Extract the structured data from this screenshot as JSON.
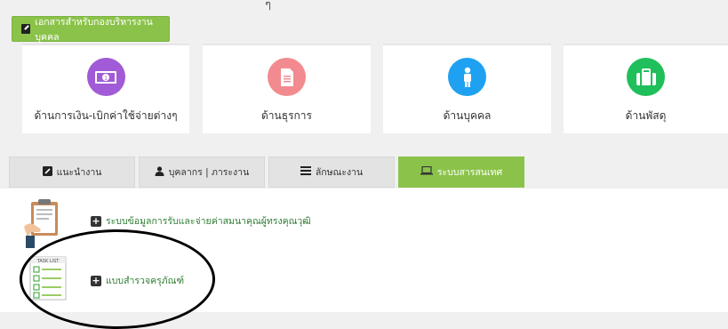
{
  "top": {
    "glyph": "ๆ"
  },
  "docs_button": {
    "label": "เอกสารสำหรับกองบริหารงานบุคคล"
  },
  "cards": [
    {
      "label": "ด้านการเงิน-เบิกค่าใช้จ่ายต่างๆ",
      "icon": "money-icon",
      "color": "#a15bd6"
    },
    {
      "label": "ด้านธุรการ",
      "icon": "document-icon",
      "color": "#f28b8f"
    },
    {
      "label": "ด้านบุคคล",
      "icon": "person-icon",
      "color": "#1ea1f1"
    },
    {
      "label": "ด้านพัสดุ",
      "icon": "briefcase-icon",
      "color": "#1fbf5b"
    }
  ],
  "tabs": [
    {
      "label": "แนะนำงาน",
      "icon": "edit-icon",
      "active": false
    },
    {
      "label": "บุคลากร | ภาระงาน",
      "icon": "user-icon",
      "active": false
    },
    {
      "label": "ลักษณะงาน",
      "icon": "list-icon",
      "active": false
    },
    {
      "label": "ระบบสารสนเทศ",
      "icon": "laptop-icon",
      "active": true
    }
  ],
  "content": {
    "items": [
      {
        "label": "ระบบข้อมูลการรับและจ่ายค่าสมนาคุณผู้ทรงคุณวุฒิ",
        "icon": "clipboard-hand-icon"
      },
      {
        "label": "แบบสำรวจครุภัณฑ์",
        "icon": "task-list-icon"
      }
    ],
    "task_list_text": "TASK LIST"
  }
}
